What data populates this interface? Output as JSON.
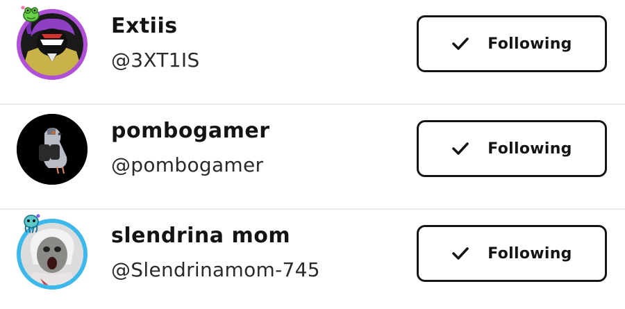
{
  "users": [
    {
      "name": "Extiis",
      "handle": "@3XT1IS",
      "button_label": "Following",
      "avatar_icon": "hooded-character-avatar",
      "badge_icon": "green-frog-badge",
      "ring_color": "#b04fd8"
    },
    {
      "name": "pombogamer",
      "handle": "@pombogamer",
      "button_label": "Following",
      "avatar_icon": "pigeon-avatar",
      "ring_color": "#000000"
    },
    {
      "name": "slendrina mom",
      "handle": "@Slendrinamom-745",
      "button_label": "Following",
      "avatar_icon": "ghoul-granny-avatar",
      "badge_icon": "blue-octopus-badge",
      "ring_color": "#3cb8ea"
    }
  ],
  "colors": {
    "text": "#141414",
    "divider": "#ececec",
    "button_border": "#141414"
  }
}
